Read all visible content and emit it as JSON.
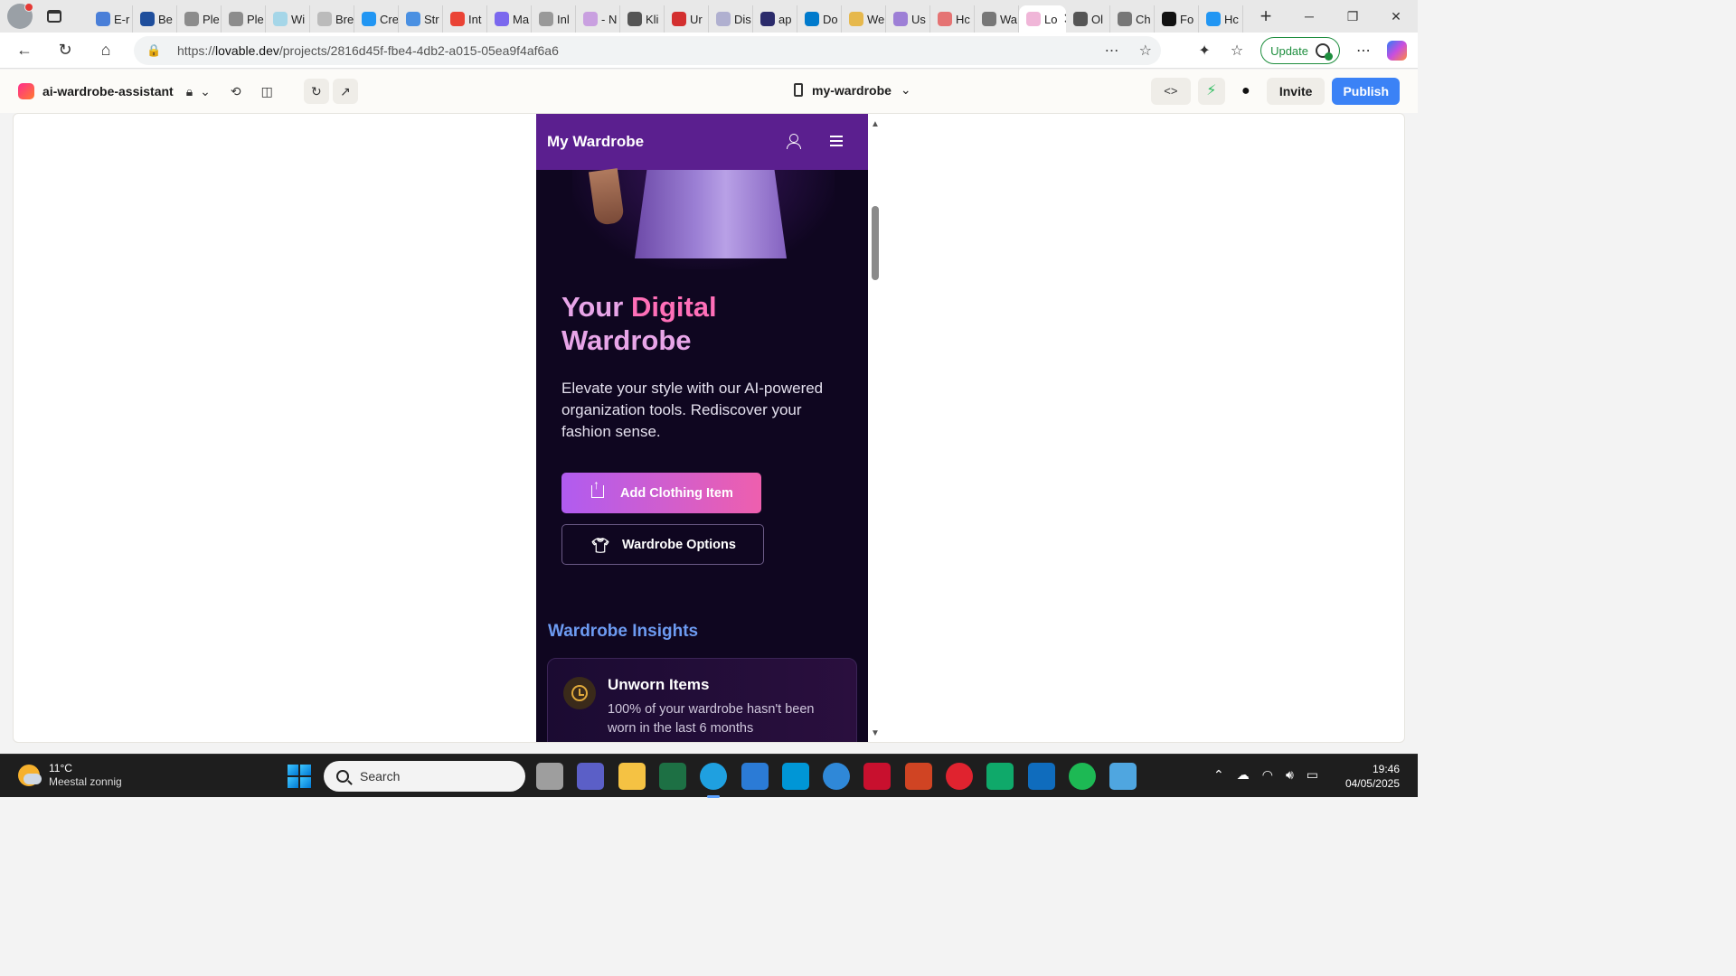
{
  "browser": {
    "tabs": [
      {
        "label": "E-r",
        "color": "#4a7fd8"
      },
      {
        "label": "Be",
        "color": "#1f4e9c"
      },
      {
        "label": "Ple",
        "color": "#8c8c8c"
      },
      {
        "label": "Ple",
        "color": "#8c8c8c"
      },
      {
        "label": "Wi",
        "color": "#a5d6e8"
      },
      {
        "label": "Bre",
        "color": "#bbbbbb"
      },
      {
        "label": "Cre",
        "color": "#2196f3"
      },
      {
        "label": "Str",
        "color": "#4a90e2"
      },
      {
        "label": "Int",
        "color": "#ea4335"
      },
      {
        "label": "Ma",
        "color": "#7b68ee"
      },
      {
        "label": "Inl",
        "color": "#999999"
      },
      {
        "label": "- N",
        "color": "#c9a0e0"
      },
      {
        "label": "Kli",
        "color": "#555555"
      },
      {
        "label": "Ur",
        "color": "#d32f2f"
      },
      {
        "label": "Dis",
        "color": "#b0b0d0"
      },
      {
        "label": "ap",
        "color": "#2b2b6b"
      },
      {
        "label": "Do",
        "color": "#007acc"
      },
      {
        "label": "We",
        "color": "#e6b84c"
      },
      {
        "label": "Us",
        "color": "#9d7fd6"
      },
      {
        "label": "Hc",
        "color": "#e57373"
      },
      {
        "label": "Wa",
        "color": "#777777"
      }
    ],
    "active_tab": {
      "label": "Lo",
      "color": "#ffffff"
    },
    "tabs_after": [
      {
        "label": "Ol",
        "color": "#555555"
      },
      {
        "label": "Ch",
        "color": "#777777"
      },
      {
        "label": "Fo",
        "color": "#111111"
      },
      {
        "label": "Hc",
        "color": "#2196f3"
      }
    ],
    "url_prefix": "https://",
    "url_domain": "lovable.dev",
    "url_path": "/projects/2816d45f-fbe4-4db2-a015-05ea9f4af6a6",
    "update_label": "Update"
  },
  "app": {
    "project_name": "ai-wardrobe-assistant",
    "device_label": "my-wardrobe",
    "invite_label": "Invite",
    "publish_label": "Publish"
  },
  "preview": {
    "header_title": "My Wardrobe",
    "hero_title_part1": "Your ",
    "hero_title_part2": "Digital",
    "hero_title_part3": "Wardrobe",
    "hero_description": "Elevate your style with our AI-powered organization tools. Rediscover your fashion sense.",
    "primary_button": "Add Clothing Item",
    "secondary_button": "Wardrobe Options",
    "insights_heading": "Wardrobe Insights",
    "card_title": "Unworn Items",
    "card_text": "100% of your wardrobe hasn't been worn in the last 6 months"
  },
  "taskbar": {
    "temperature": "11°C",
    "weather": "Meestal zonnig",
    "search_placeholder": "Search",
    "time": "19:46",
    "date": "04/05/2025",
    "apps": [
      {
        "name": "file-explorer-view",
        "color": "#9e9e9e"
      },
      {
        "name": "teams",
        "color": "#5b5fc7"
      },
      {
        "name": "folder",
        "color": "#f5c243"
      },
      {
        "name": "excel",
        "color": "#1d7044"
      },
      {
        "name": "edge",
        "color": "#1fa0e0"
      },
      {
        "name": "store",
        "color": "#2b7bd6"
      },
      {
        "name": "myhp",
        "color": "#0096d6"
      },
      {
        "name": "help",
        "color": "#2f88d8"
      },
      {
        "name": "mcafee",
        "color": "#c8102e"
      },
      {
        "name": "powerpoint",
        "color": "#d04423"
      },
      {
        "name": "opera",
        "color": "#e0232f"
      },
      {
        "name": "bing",
        "color": "#0fa96a"
      },
      {
        "name": "outlook",
        "color": "#0f6cbd"
      },
      {
        "name": "spotify",
        "color": "#1db954"
      },
      {
        "name": "notepad",
        "color": "#4fa6e0"
      }
    ]
  }
}
